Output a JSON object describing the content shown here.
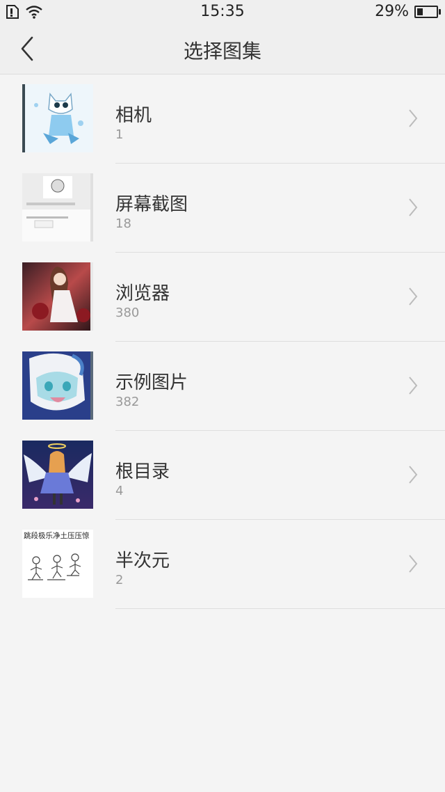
{
  "status_bar": {
    "time": "15:35",
    "battery_percent": "29%",
    "battery_level": 0.29
  },
  "header": {
    "title": "选择图集"
  },
  "albums": [
    {
      "name": "相机",
      "count": "1"
    },
    {
      "name": "屏幕截图",
      "count": "18"
    },
    {
      "name": "浏览器",
      "count": "380"
    },
    {
      "name": "示例图片",
      "count": "382"
    },
    {
      "name": "根目录",
      "count": "4"
    },
    {
      "name": "半次元",
      "count": "2"
    }
  ],
  "thumb_text": {
    "album5": "跳段极乐净土压压惊"
  },
  "icons": [
    "sim-icon",
    "wifi-icon",
    "battery-icon",
    "back-arrow-icon",
    "chevron-right-icon"
  ],
  "colors": {
    "background": "#f4f4f4",
    "header_bg": "#efefef",
    "count_text": "#999999"
  }
}
